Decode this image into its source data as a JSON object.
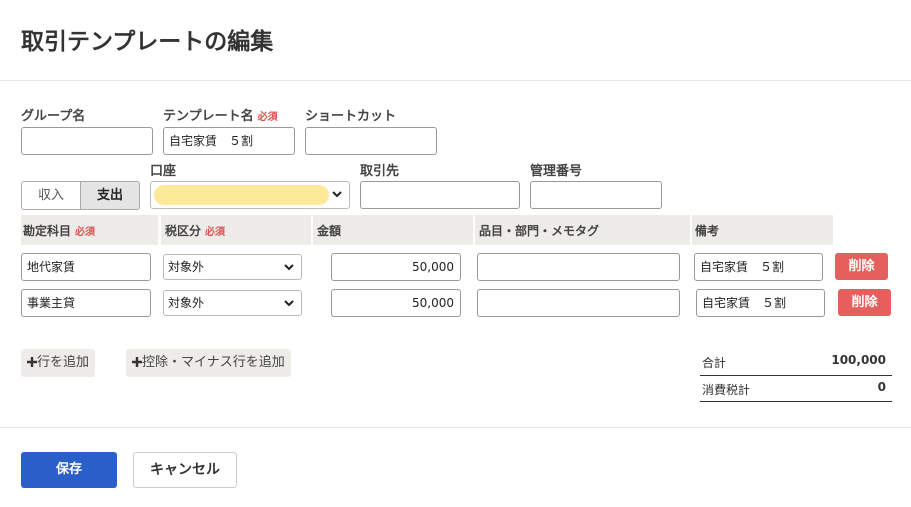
{
  "title": "取引テンプレートの編集",
  "labels": {
    "group_name": "グループ名",
    "template_name": "テンプレート名",
    "shortcut": "ショートカット",
    "required": "必須",
    "account": "口座",
    "partner": "取引先",
    "ref_number": "管理番号"
  },
  "fields": {
    "group_name": "",
    "template_name": "自宅家賃　５割",
    "shortcut": "",
    "account": "",
    "partner": "",
    "ref_number": ""
  },
  "toggle": {
    "income": "収入",
    "expense": "支出",
    "selected": "expense"
  },
  "table": {
    "headers": [
      "勘定科目",
      "税区分",
      "金額",
      "品目・部門・メモタグ",
      "備考"
    ],
    "rows": [
      {
        "account": "地代家賃",
        "tax": "対象外",
        "amount": "50,000",
        "tags": "",
        "note": "自宅家賃　５割",
        "delete": "削除"
      },
      {
        "account": "事業主貸",
        "tax": "対象外",
        "amount": "50,000",
        "tags": "",
        "note": "自宅家賃　５割",
        "delete": "削除"
      }
    ]
  },
  "actions": {
    "add_row": "行を追加",
    "add_deduction_row": "控除・マイナス行を追加"
  },
  "summary": {
    "total_label": "合計",
    "total_value": "100,000",
    "tax_label": "消費税計",
    "tax_value": "0"
  },
  "footer": {
    "save": "保存",
    "cancel": "キャンセル"
  },
  "colors": {
    "primary": "#2a5fc9",
    "danger": "#e5605c",
    "highlight": "#fde99a",
    "header_bg": "#eeece8"
  }
}
